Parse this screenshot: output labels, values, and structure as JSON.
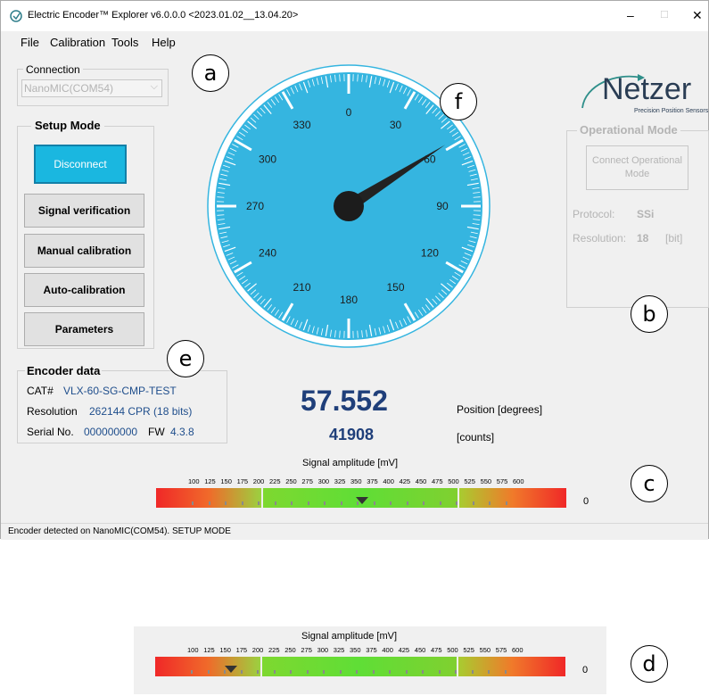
{
  "window": {
    "title": "Electric Encoder™ Explorer v6.0.0.0  <2023.01.02__13.04.20>",
    "controls": [
      "–",
      "□",
      "✕"
    ]
  },
  "menu": [
    "File",
    "Calibration",
    "Tools",
    "Help"
  ],
  "connection": {
    "label": "Connection",
    "selected": "NanoMIC(COM54)"
  },
  "setup_mode": {
    "title": "Setup Mode",
    "buttons": [
      "Disconnect",
      "Signal verification",
      "Manual calibration",
      "Auto-calibration",
      "Parameters"
    ]
  },
  "encoder_data": {
    "title": "Encoder data",
    "cat_label": "CAT#",
    "cat_value": "VLX-60-SG-CMP-TEST",
    "resolution_label": "Resolution",
    "resolution_value": "262144 CPR (18 bits)",
    "serial_label": "Serial No.",
    "serial_value": "000000000",
    "fw_label": "FW",
    "fw_value": "4.3.8"
  },
  "dial": {
    "labels": [
      "0",
      "30",
      "60",
      "90",
      "120",
      "150",
      "180",
      "210",
      "240",
      "270",
      "300",
      "330"
    ],
    "needle_degrees": 57.552,
    "face_color": "#35b5e0"
  },
  "logo": {
    "name": "Netzer",
    "tagline": "Precision Position Sensors"
  },
  "operational_mode": {
    "title": "Operational Mode",
    "button": "Connect Operational Mode",
    "protocol_label": "Protocol:",
    "protocol_value": "SSi",
    "resolution_label": "Resolution:",
    "resolution_value": "18",
    "resolution_unit": "[bit]"
  },
  "position": {
    "degrees": "57.552",
    "degrees_label": "Position [degrees]",
    "counts": "41908",
    "counts_label": "[counts]"
  },
  "signal": {
    "title": "Signal amplitude [mV]",
    "scale": [
      "100",
      "125",
      "150",
      "175",
      "200",
      "225",
      "250",
      "275",
      "300",
      "325",
      "350",
      "375",
      "400",
      "425",
      "450",
      "475",
      "500",
      "525",
      "550",
      "575",
      "600"
    ],
    "value_label": "0",
    "main_marker_mv": 350,
    "lower_marker_mv": 150
  },
  "status_bar": "Encoder detected on NanoMIC(COM54). SETUP MODE",
  "callouts": [
    "a",
    "b",
    "c",
    "d",
    "e",
    "f"
  ]
}
